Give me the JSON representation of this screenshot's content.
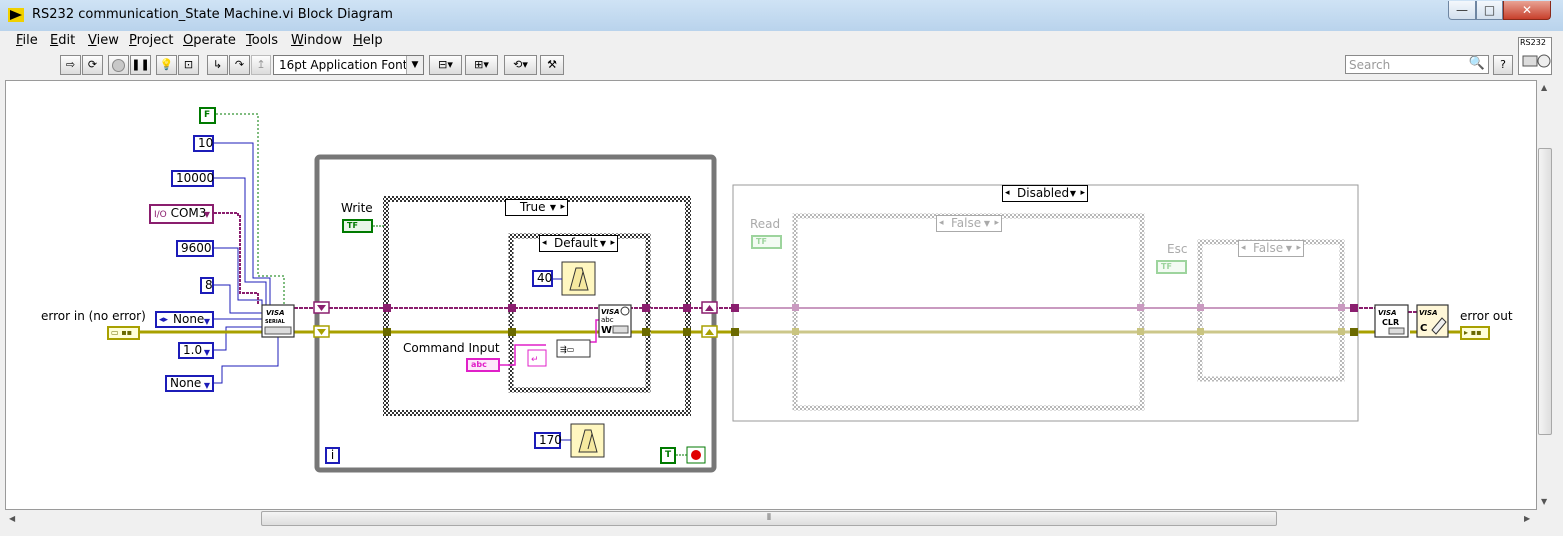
{
  "window": {
    "title": "RS232 communication_State Machine.vi Block Diagram",
    "minimize": "—",
    "maximize": "□",
    "close": "✕"
  },
  "menu": [
    "File",
    "Edit",
    "View",
    "Project",
    "Operate",
    "Tools",
    "Window",
    "Help"
  ],
  "toolbar": {
    "font": "16pt Application Font",
    "search_placeholder": "Search",
    "help": "?"
  },
  "vi_icon": {
    "label": "RS232"
  },
  "constants": {
    "bool_false": "F",
    "data_bits_timeout": "10",
    "timeout": "10000",
    "port": "COM3",
    "baud": "9600",
    "data_bits": "8",
    "parity": "None",
    "stop_bits": "1.0",
    "flow": "None",
    "wait_inner": "40",
    "wait_loop": "170",
    "bool_true": "T",
    "loop_index": "i"
  },
  "labels": {
    "error_in": "error in (no error)",
    "error_out": "error out",
    "write": "Write",
    "command_input": "Command Input",
    "read": "Read",
    "esc": "Esc"
  },
  "case_selectors": {
    "outer": "True",
    "inner": "Default",
    "disabled": "Disabled",
    "read_case": "False",
    "esc_case": "False"
  },
  "terminals": {
    "tf": "TF",
    "abc": "abc",
    "visa_serial": "VISA SERIAL",
    "visa_write": "VISA abc W",
    "visa_clr": "VISA CLR",
    "visa_close": "VISA C"
  },
  "colors": {
    "error_wire": "#a8a000",
    "visa_wire": "#8a1e6e",
    "numeric": "#1c1cb8",
    "boolean": "#007a00",
    "string": "#e020c8",
    "enum_ring": "#1c1cb8"
  }
}
